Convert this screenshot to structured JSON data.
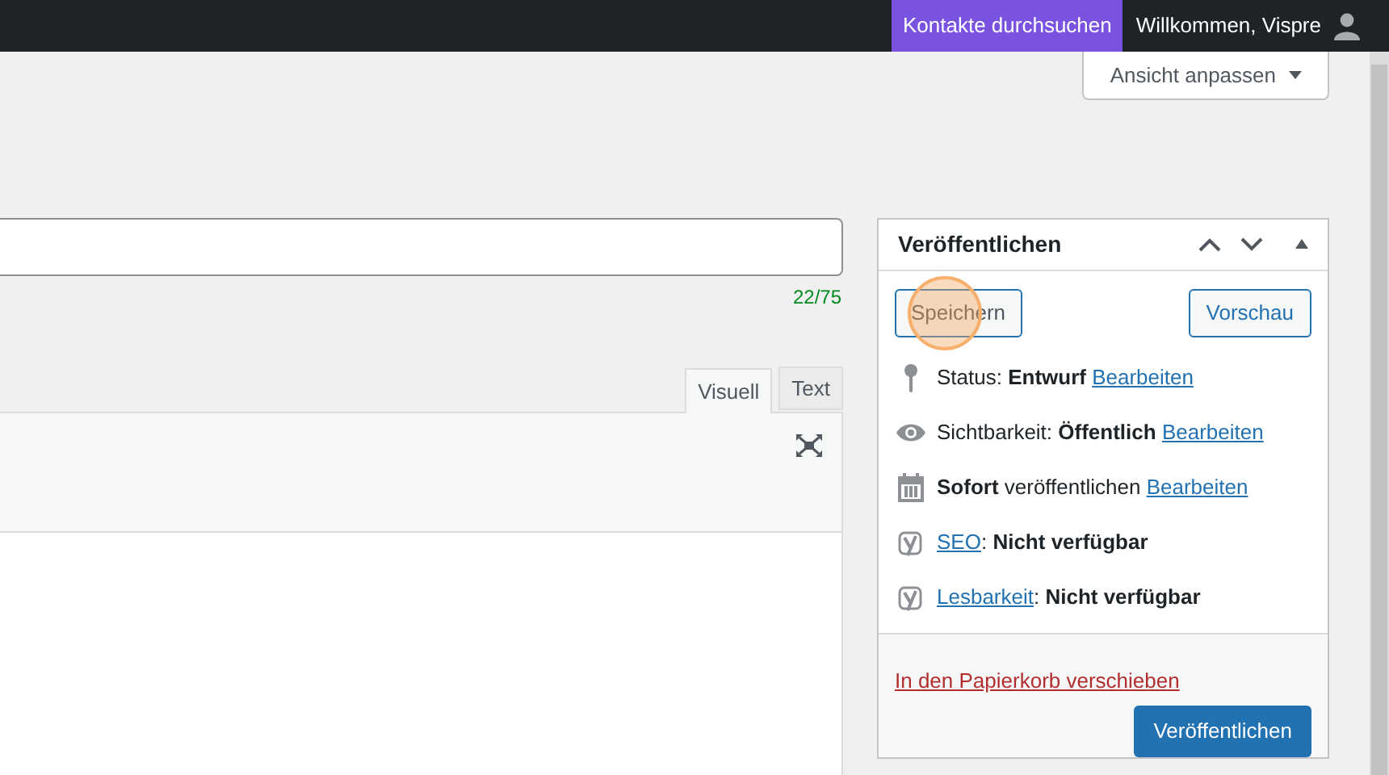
{
  "admin_bar": {
    "search_label": "Kontakte durchsuchen",
    "greeting": "Willkommen, Vispre"
  },
  "screen_options": {
    "label": "Ansicht anpassen",
    "expanded": false
  },
  "title_counter": "22/75",
  "editor_tabs": [
    {
      "label": "Visuell",
      "selected": true
    },
    {
      "label": "Text",
      "selected": false
    }
  ],
  "publish_box": {
    "title": "Veröffentlichen",
    "expanded": true,
    "save_label": "Speichern",
    "preview_label": "Vorschau",
    "rows": [
      {
        "kind": "status",
        "before": "Status: **Entwurf** ",
        "link": "Bearbeiten"
      },
      {
        "kind": "visibility",
        "before": "Sichtbarkeit: **Öffentlich** ",
        "link": "Bearbeiten"
      },
      {
        "kind": "schedule",
        "before": "**Sofort** veröffentlichen ",
        "link": "Bearbeiten"
      },
      {
        "kind": "seo",
        "link": "SEO",
        "after": ": **Nicht verfügbar**"
      },
      {
        "kind": "readability",
        "link": "Lesbarkeit",
        "after": ": **Nicht verfügbar**"
      }
    ],
    "trash_label": "In den Papierkorb verschieben",
    "publish_label": "Veröffentlichen"
  }
}
